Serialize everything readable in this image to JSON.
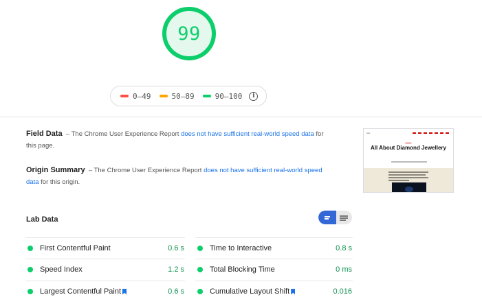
{
  "score": {
    "value": "99",
    "fraction": 0.99,
    "color": "#0cce6b"
  },
  "legend": [
    {
      "label": "0–49",
      "color": "#ff4e42"
    },
    {
      "label": "50–89",
      "color": "#ffa400"
    },
    {
      "label": "90–100",
      "color": "#0cce6b"
    }
  ],
  "legend_info_icon": "info-icon",
  "field_data": {
    "title": "Field Data",
    "dash": "–",
    "text_before": "The Chrome User Experience Report",
    "link": "does not have sufficient real-world speed data",
    "text_after": "for this page."
  },
  "origin_summary": {
    "title": "Origin Summary",
    "dash": "–",
    "text_before": "The Chrome User Experience Report",
    "link": "does not have sufficient real-world speed data",
    "text_after": "for this origin."
  },
  "thumbnail": {
    "heading": "All About Diamond Jewellery"
  },
  "lab_data": {
    "title": "Lab Data",
    "metrics_left": [
      {
        "name": "First Contentful Paint",
        "value": "0.6 s",
        "bookmark": false
      },
      {
        "name": "Speed Index",
        "value": "1.2 s",
        "bookmark": false
      },
      {
        "name": "Largest Contentful Paint",
        "value": "0.6 s",
        "bookmark": true
      }
    ],
    "metrics_right": [
      {
        "name": "Time to Interactive",
        "value": "0.8 s",
        "bookmark": false
      },
      {
        "name": "Total Blocking Time",
        "value": "0 ms",
        "bookmark": false
      },
      {
        "name": "Cumulative Layout Shift",
        "value": "0.016",
        "bookmark": true
      }
    ]
  },
  "colors": {
    "pass": "#0cce6b",
    "link": "#1a73e8",
    "toggle_active": "#3367d6"
  }
}
